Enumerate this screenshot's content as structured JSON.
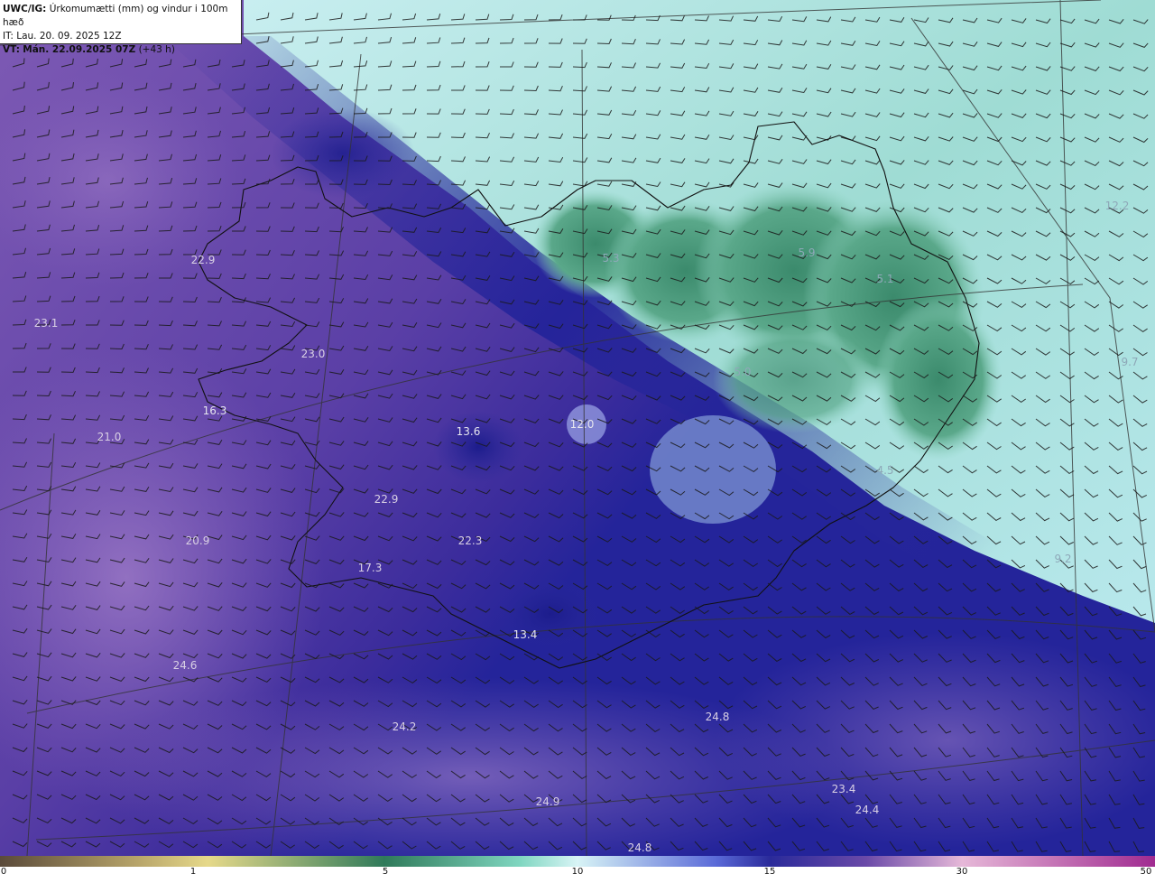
{
  "header": {
    "model_code": "UWC/IG:",
    "title": "Úrkomumætti (mm) og vindur i 100m hæð",
    "issue_time": "IT: Lau. 20. 09. 2025 12Z",
    "valid_prefix": "VT:",
    "valid_time": "Mán. 22.09.2025 07Z",
    "lead_time": "(+43 h)"
  },
  "map_values": [
    {
      "id": "v1",
      "text": "22.9",
      "tone": "normal"
    },
    {
      "id": "v2",
      "text": "23.1",
      "tone": "normal"
    },
    {
      "id": "v3",
      "text": "23.0",
      "tone": "normal"
    },
    {
      "id": "v4",
      "text": "16.3",
      "tone": "dark"
    },
    {
      "id": "v5",
      "text": "21.0",
      "tone": "normal"
    },
    {
      "id": "v6",
      "text": "13.6",
      "tone": "dark"
    },
    {
      "id": "v7",
      "text": "12.0",
      "tone": "dark"
    },
    {
      "id": "v8",
      "text": "5.3",
      "tone": "light"
    },
    {
      "id": "v9",
      "text": "5.9",
      "tone": "light"
    },
    {
      "id": "v10",
      "text": "5.1",
      "tone": "light"
    },
    {
      "id": "v11",
      "text": "12.2",
      "tone": "light"
    },
    {
      "id": "v12",
      "text": "9.7",
      "tone": "light"
    },
    {
      "id": "v13",
      "text": "5.0",
      "tone": "light"
    },
    {
      "id": "v14",
      "text": "4.5",
      "tone": "light"
    },
    {
      "id": "v15",
      "text": "22.9",
      "tone": "normal"
    },
    {
      "id": "v16",
      "text": "20.9",
      "tone": "normal"
    },
    {
      "id": "v17",
      "text": "22.3",
      "tone": "normal"
    },
    {
      "id": "v18",
      "text": "17.3",
      "tone": "normal"
    },
    {
      "id": "v19",
      "text": "13.4",
      "tone": "dark"
    },
    {
      "id": "v20",
      "text": "24.6",
      "tone": "normal"
    },
    {
      "id": "v21",
      "text": "24.2",
      "tone": "normal"
    },
    {
      "id": "v22",
      "text": "24.8",
      "tone": "normal"
    },
    {
      "id": "v23",
      "text": "23.4",
      "tone": "normal"
    },
    {
      "id": "v24",
      "text": "24.4",
      "tone": "normal"
    },
    {
      "id": "v25",
      "text": "24.9",
      "tone": "normal"
    },
    {
      "id": "v26",
      "text": "24.8",
      "tone": "normal"
    },
    {
      "id": "v27",
      "text": "9.2",
      "tone": "light"
    }
  ],
  "colorbar": {
    "ticks": [
      "0",
      "1",
      "5",
      "10",
      "15",
      "30",
      "50"
    ],
    "colors": [
      "#5a4a3a",
      "#b8a56a",
      "#e6d98a",
      "#2f7a5a",
      "#7fd6c0",
      "#d8f4f6",
      "#2a2a9a",
      "#6a4aa8",
      "#e6b8d8",
      "#a02a90"
    ]
  },
  "palette": {
    "wet": "#6b4aa8",
    "moderate": "#2d2a9c",
    "dry_green": "#3f8f72",
    "dry_cyan": "#a8e0da",
    "coast": "#111111"
  }
}
